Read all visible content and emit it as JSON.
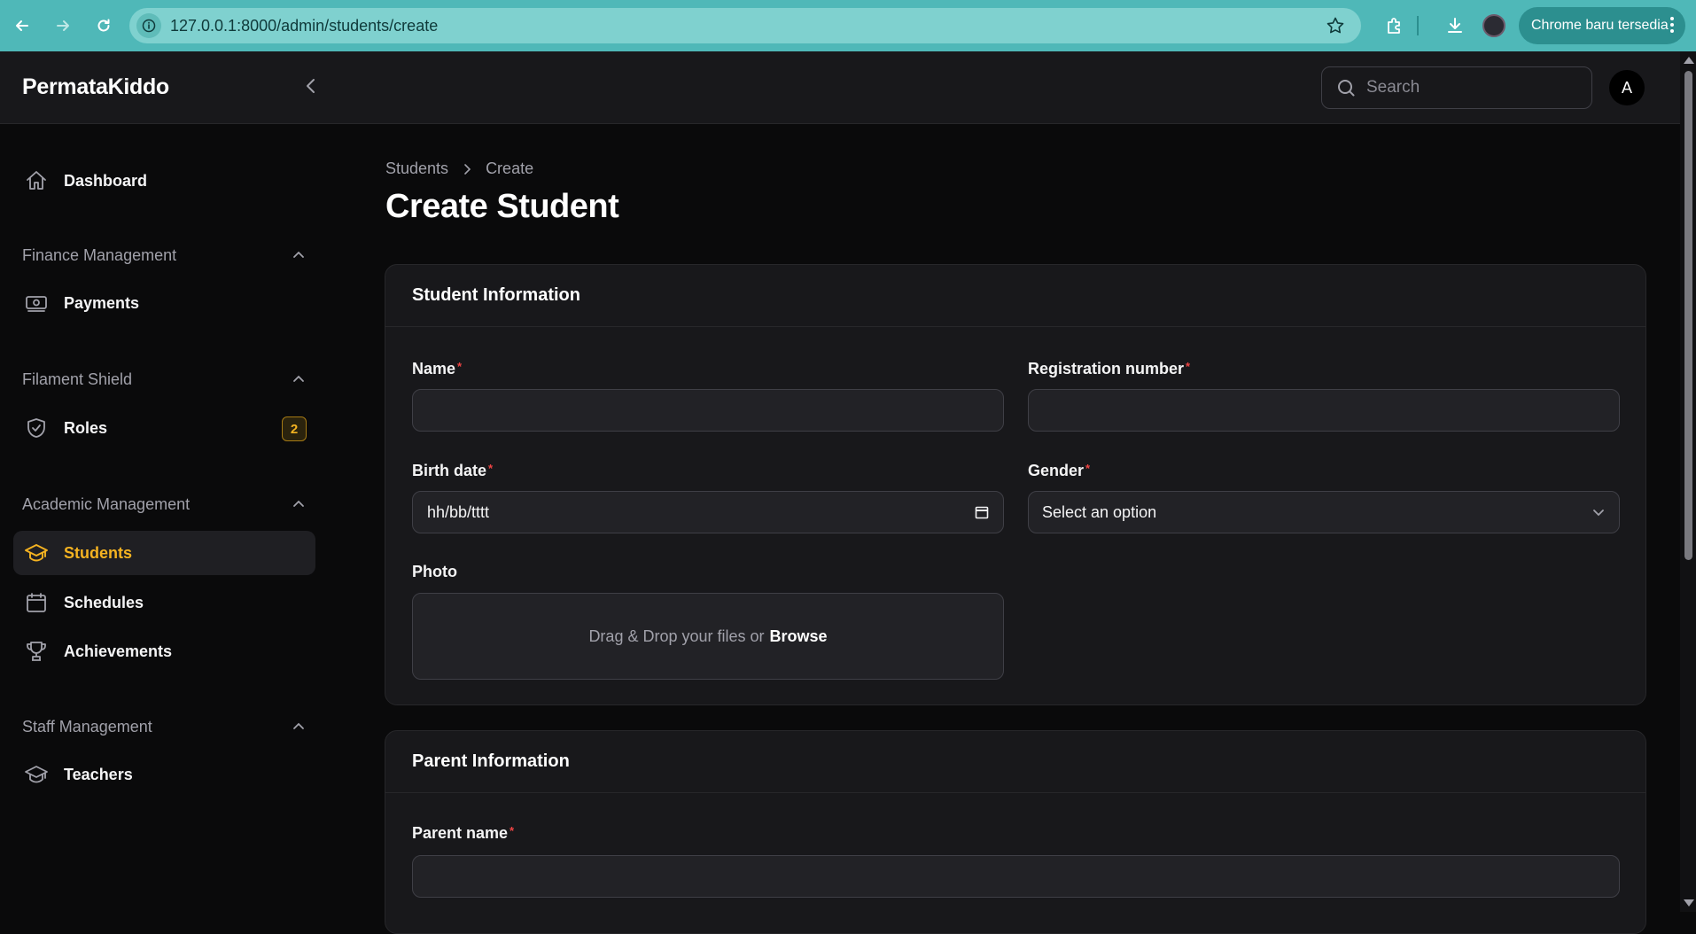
{
  "browser": {
    "url": "127.0.0.1:8000/admin/students/create",
    "update_label": "Chrome baru tersedia"
  },
  "app": {
    "brand": "PermataKiddo",
    "search_placeholder": "Search",
    "avatar_initial": "A"
  },
  "sidebar": {
    "dashboard": "Dashboard",
    "groups": [
      {
        "label": "Finance Management",
        "items": [
          {
            "label": "Payments",
            "icon": "cash-icon"
          }
        ]
      },
      {
        "label": "Filament Shield",
        "items": [
          {
            "label": "Roles",
            "icon": "shield-check-icon",
            "badge": "2"
          }
        ]
      },
      {
        "label": "Academic Management",
        "items": [
          {
            "label": "Students",
            "icon": "academic-cap-icon",
            "active": true
          },
          {
            "label": "Schedules",
            "icon": "calendar-icon"
          },
          {
            "label": "Achievements",
            "icon": "trophy-icon"
          }
        ]
      },
      {
        "label": "Staff Management",
        "items": [
          {
            "label": "Teachers",
            "icon": "academic-cap-icon"
          }
        ]
      }
    ]
  },
  "breadcrumb": {
    "parent": "Students",
    "current": "Create"
  },
  "page_title": "Create Student",
  "student_section": {
    "title": "Student Information",
    "name_label": "Name",
    "registration_label": "Registration number",
    "birth_label": "Birth date",
    "birth_value": "hh/bb/tttt",
    "gender_label": "Gender",
    "gender_value": "Select an option",
    "photo_label": "Photo",
    "photo_hint": "Drag & Drop your files or",
    "photo_browse": "Browse"
  },
  "parent_section": {
    "title": "Parent Information",
    "parent_name_label": "Parent name"
  },
  "colors": {
    "browser_bar": "#4fb8b8",
    "accent": "#f5b321",
    "required": "#ef4444",
    "card_bg": "#18181b",
    "page_bg": "#0a0a0b"
  }
}
